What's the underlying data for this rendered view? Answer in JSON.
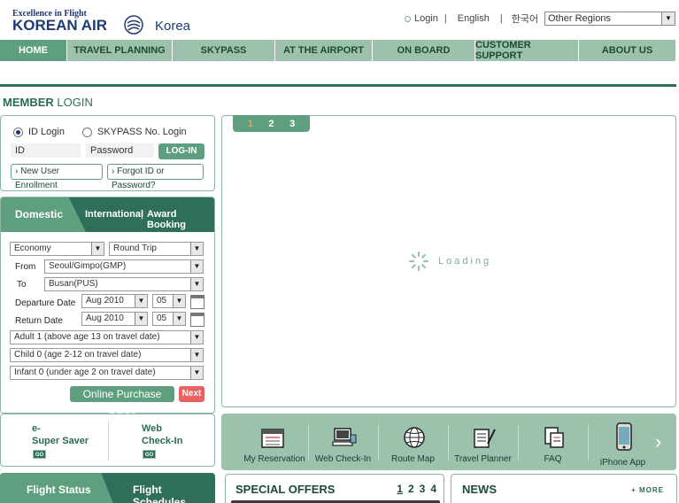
{
  "header": {
    "tagline": "Excellence in Flight",
    "logo": "KOREAN AIR",
    "country": "Korea",
    "links": {
      "login": "Login",
      "english": "English",
      "korean": "한국어"
    },
    "region": "Other Regions"
  },
  "nav": {
    "items": [
      "HOME",
      "TRAVEL PLANNING",
      "SKYPASS",
      "AT THE AIRPORT",
      "ON BOARD",
      "CUSTOMER SUPPORT",
      "ABOUT US"
    ]
  },
  "member": {
    "title_bold": "MEMBER",
    "title_rest": " LOGIN",
    "radio_id": "ID Login",
    "radio_skypass": "SKYPASS No. Login",
    "id_placeholder": "ID",
    "password_placeholder": "Password",
    "login_btn": "LOG-IN",
    "enroll": "New User Enrollment",
    "forgot": "Forgot ID or Password?"
  },
  "booking": {
    "tab_domestic": "Domestic",
    "tab_international": "International",
    "tab_sep": "|",
    "tab_award": "Award Booking",
    "cabin": "Economy",
    "trip": "Round Trip",
    "from_label": "From",
    "from_value": "Seoul/Gimpo(GMP)",
    "to_label": "To",
    "to_value": "Busan(PUS)",
    "depart_label": "Departure Date",
    "depart_month": "Aug 2010",
    "depart_day": "05",
    "return_label": "Return Date",
    "return_month": "Aug 2010",
    "return_day": "05",
    "adult": "Adult 1 (above age 13 on travel date)",
    "child": "Child 0 (age 2-12 on travel date)",
    "infant": "Infant 0 (under age 2 on travel date)",
    "guide_btn": "Online Purchase Guide",
    "next_btn": "Next"
  },
  "saver": {
    "e_line1": "e-",
    "e_line2": "Super Saver",
    "web_line1": "Web",
    "web_line2": "Check-In",
    "go": "GO"
  },
  "flight": {
    "status": "Flight Status",
    "schedules": "Flight Schedules"
  },
  "banner": {
    "pages": [
      "1",
      "2",
      "3"
    ],
    "loading": "Loading"
  },
  "quick": {
    "items": [
      "My Reservation",
      "Web Check-In",
      "Route Map",
      "Travel Planner",
      "FAQ",
      "iPhone App"
    ]
  },
  "offers": {
    "title": "SPECIAL OFFERS",
    "pages": [
      "1",
      "2",
      "3",
      "4"
    ]
  },
  "news": {
    "title": "NEWS",
    "more": "+ MORE"
  }
}
